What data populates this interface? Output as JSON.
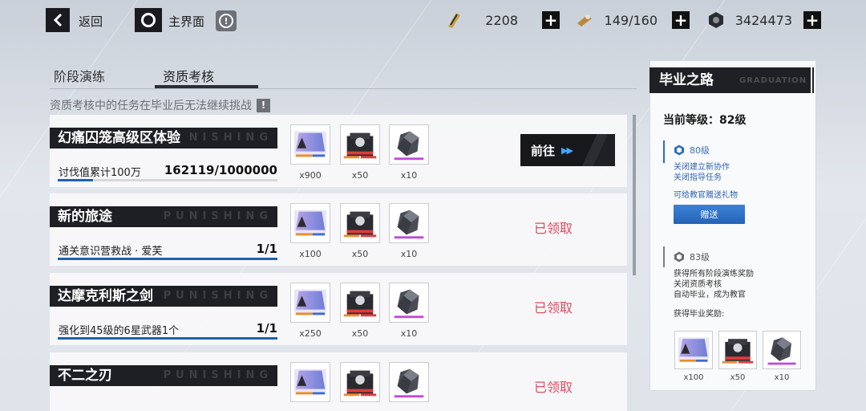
{
  "topbar": {
    "back_label": "返回",
    "home_label": "主界面",
    "info_icon": "!",
    "resources": [
      {
        "icon": "ticket-icon",
        "value": "2208"
      },
      {
        "icon": "stamina-icon",
        "value": "149/160"
      },
      {
        "icon": "coin-icon",
        "value": "3424473"
      }
    ],
    "plus": "+"
  },
  "tabs": [
    {
      "label": "阶段演练",
      "active": false
    },
    {
      "label": "资质考核",
      "active": true
    }
  ],
  "notice": {
    "text": "资质考核中的任务在毕业后无法继续挑战",
    "icon": "!"
  },
  "watermark": "PUNISHING",
  "tasks": [
    {
      "title": "幻痛囚笼高级区体验",
      "watermark": "NISHING",
      "desc": "讨伐值累计100万",
      "progress_text": "162119/1000000",
      "progress": 0.162,
      "rewards": [
        {
          "icon": "purple-card-icon",
          "qty": "x900"
        },
        {
          "icon": "supply-box-icon",
          "qty": "x50"
        },
        {
          "icon": "ore-icon",
          "qty": "x10"
        }
      ],
      "state": "go",
      "action_label": "前往",
      "action_arrow": "▶▶"
    },
    {
      "title": "新的旅途",
      "watermark": "PUNISHING",
      "desc": "通关意识营救战 · 爱芙",
      "progress_text": "1/1",
      "progress": 1.0,
      "rewards": [
        {
          "icon": "purple-card-icon",
          "qty": "x100"
        },
        {
          "icon": "supply-box-icon",
          "qty": "x50"
        },
        {
          "icon": "ore-icon",
          "qty": "x10"
        }
      ],
      "state": "claimed",
      "action_label": "已领取"
    },
    {
      "title": "达摩克利斯之剑",
      "watermark": "PUNISHING",
      "desc": "强化到45级的6星武器1个",
      "progress_text": "1/1",
      "progress": 1.0,
      "rewards": [
        {
          "icon": "purple-card-icon",
          "qty": "x250"
        },
        {
          "icon": "supply-box-icon",
          "qty": "x50"
        },
        {
          "icon": "ore-icon",
          "qty": "x10"
        }
      ],
      "state": "claimed",
      "action_label": "已领取"
    },
    {
      "title": "不二之刃",
      "watermark": "PUNISHING",
      "desc": "",
      "progress_text": "",
      "progress": 0,
      "rewards": [
        {
          "icon": "purple-card-icon",
          "qty": ""
        },
        {
          "icon": "supply-box-icon",
          "qty": ""
        },
        {
          "icon": "ore-icon",
          "qty": ""
        }
      ],
      "state": "claimed",
      "action_label": "已领取"
    }
  ],
  "panel": {
    "title": "毕业之路",
    "watermark": "GRADUATION",
    "current_level": "当前等级：82级",
    "level_80": {
      "label": "80级",
      "lines": [
        "关闭建立新协作",
        "关闭指导任务"
      ],
      "gift_text": "可给教官赠送礼物",
      "gift_button": "赠送"
    },
    "level_83": {
      "label": "83级",
      "lines": [
        "获得所有阶段演练奖励",
        "关闭资质考核",
        "自动毕业，成为教官"
      ],
      "reward_title": "获得毕业奖励:",
      "rewards": [
        {
          "icon": "purple-card-icon",
          "qty": "x100"
        },
        {
          "icon": "supply-box-icon",
          "qty": "x50"
        },
        {
          "icon": "ore-icon",
          "qty": "x10"
        }
      ]
    }
  },
  "colors": {
    "dark": "#1e1f24",
    "accent_blue": "#2161ad",
    "claimed_red": "#e04a5c"
  }
}
